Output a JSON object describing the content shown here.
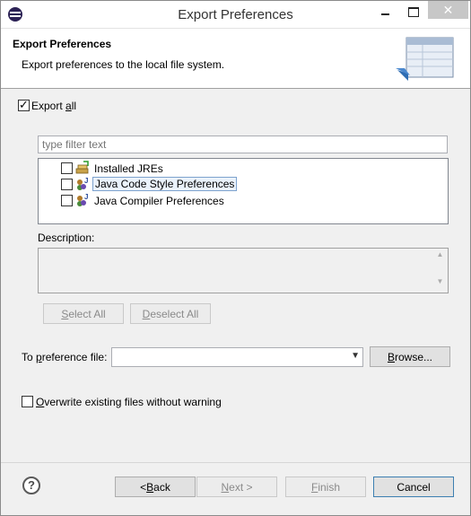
{
  "window": {
    "title": "Export Preferences"
  },
  "header": {
    "title": "Export Preferences",
    "description": "Export preferences to the local file system."
  },
  "export_all": {
    "label_pre": "Export ",
    "label_ul": "a",
    "label_post": "ll",
    "checked": true
  },
  "filter": {
    "placeholder": "type filter text",
    "value": ""
  },
  "tree": {
    "items": [
      {
        "label": "Installed JREs",
        "icon": "jre-icon",
        "checked": false
      },
      {
        "label": "Java Code Style Preferences",
        "icon": "java-preferences-icon",
        "checked": false,
        "selected": true
      },
      {
        "label": "Java Compiler Preferences",
        "icon": "java-preferences-icon",
        "checked": false
      }
    ]
  },
  "description": {
    "label": "Description:",
    "text": ""
  },
  "buttons": {
    "select_all_ul": "S",
    "select_all_rest": "elect All",
    "deselect_all_ul": "D",
    "deselect_all_rest": "eselect All",
    "browse_ul": "B",
    "browse_rest": "rowse...",
    "back_pre": "< ",
    "back_ul": "B",
    "back_rest": "ack",
    "next_ul": "N",
    "next_rest": "ext >",
    "finish_ul": "F",
    "finish_rest": "inish",
    "cancel": "Cancel"
  },
  "to_file": {
    "label_pre": "To ",
    "label_ul": "p",
    "label_post": "reference file:",
    "value": ""
  },
  "overwrite": {
    "label_pre": "",
    "label_ul": "O",
    "label_post": "verwrite existing files without warning",
    "checked": false
  },
  "help": {
    "glyph": "?"
  }
}
